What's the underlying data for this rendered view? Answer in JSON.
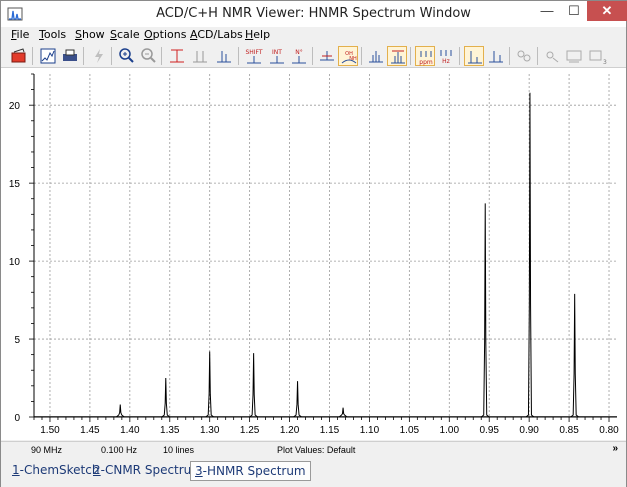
{
  "window": {
    "title": "ACD/C+H NMR Viewer: HNMR Spectrum Window",
    "minimize_glyph": "—",
    "maximize_glyph": "☐",
    "close_glyph": "✕"
  },
  "menu": [
    {
      "label": "File"
    },
    {
      "label": "Tools"
    },
    {
      "label": "Show"
    },
    {
      "label": "Scale"
    },
    {
      "label": "Options"
    },
    {
      "label": "ACD/Labs"
    },
    {
      "label": "Help"
    }
  ],
  "toolbar": {
    "buttons": [
      {
        "icon": "open-icon",
        "label": ""
      },
      {
        "icon": "chart-icon",
        "label": ""
      },
      {
        "icon": "print-icon",
        "label": ""
      },
      {
        "icon": "lightning-icon",
        "label": ""
      },
      {
        "icon": "zoom-in-icon",
        "label": ""
      },
      {
        "icon": "zoom-out-icon",
        "label": ""
      },
      {
        "icon": "full-view-icon",
        "label": ""
      },
      {
        "icon": "expand-icon",
        "label": ""
      },
      {
        "icon": "fit-icon",
        "label": ""
      },
      {
        "icon": "shift-icon",
        "label": "SHIFT"
      },
      {
        "icon": "integral-icon",
        "label": "INT"
      },
      {
        "icon": "multiplicity-icon",
        "label": "N°"
      },
      {
        "icon": "peak-pick-icon",
        "label": ""
      },
      {
        "icon": "oh-nh-icon",
        "label": "OH NH"
      },
      {
        "icon": "multiplet-icon",
        "label": ""
      },
      {
        "icon": "multiplet-range-icon",
        "label": ""
      },
      {
        "icon": "ppm-icon",
        "label": "ppm"
      },
      {
        "icon": "hz-icon",
        "label": "Hz"
      },
      {
        "icon": "spectrum-a-icon",
        "label": ""
      },
      {
        "icon": "spectrum-b-icon",
        "label": ""
      },
      {
        "icon": "molecule-icon",
        "label": ""
      },
      {
        "icon": "tools-a-icon",
        "label": ""
      },
      {
        "icon": "tools-b-icon",
        "label": ""
      },
      {
        "icon": "tools-c-icon",
        "label": ""
      }
    ]
  },
  "status": {
    "frequency": "90 MHz",
    "resolution": "0.100 Hz",
    "lines": "10 lines",
    "plot_values": "Plot Values: Default",
    "more": "»"
  },
  "tabs": [
    {
      "num": "1",
      "label": "-ChemSketch",
      "active": false
    },
    {
      "num": "2",
      "label": "-CNMR Spectrum",
      "active": false
    },
    {
      "num": "3",
      "label": "-HNMR Spectrum",
      "active": true
    }
  ],
  "chart_data": {
    "type": "line",
    "title": "",
    "xlabel": "",
    "ylabel": "",
    "xlim": [
      1.52,
      0.79
    ],
    "ylim": [
      0,
      22
    ],
    "x_reversed": true,
    "x_ticks": [
      "1.50",
      "1.45",
      "1.40",
      "1.35",
      "1.30",
      "1.25",
      "1.20",
      "1.15",
      "1.10",
      "1.05",
      "1.00",
      "0.95",
      "0.90",
      "0.85",
      "0.80"
    ],
    "y_ticks": [
      "0",
      "5",
      "10",
      "15",
      "20"
    ],
    "grid": true,
    "peaks": [
      {
        "x": 1.412,
        "y": 0.8
      },
      {
        "x": 1.355,
        "y": 2.5
      },
      {
        "x": 1.3,
        "y": 4.2
      },
      {
        "x": 1.245,
        "y": 4.1
      },
      {
        "x": 1.19,
        "y": 2.3
      },
      {
        "x": 1.133,
        "y": 0.6
      },
      {
        "x": 0.955,
        "y": 13.7
      },
      {
        "x": 0.899,
        "y": 20.8
      },
      {
        "x": 0.843,
        "y": 7.9
      }
    ],
    "colors": {
      "line": "#000000",
      "grid": "#9a9a9a"
    }
  }
}
